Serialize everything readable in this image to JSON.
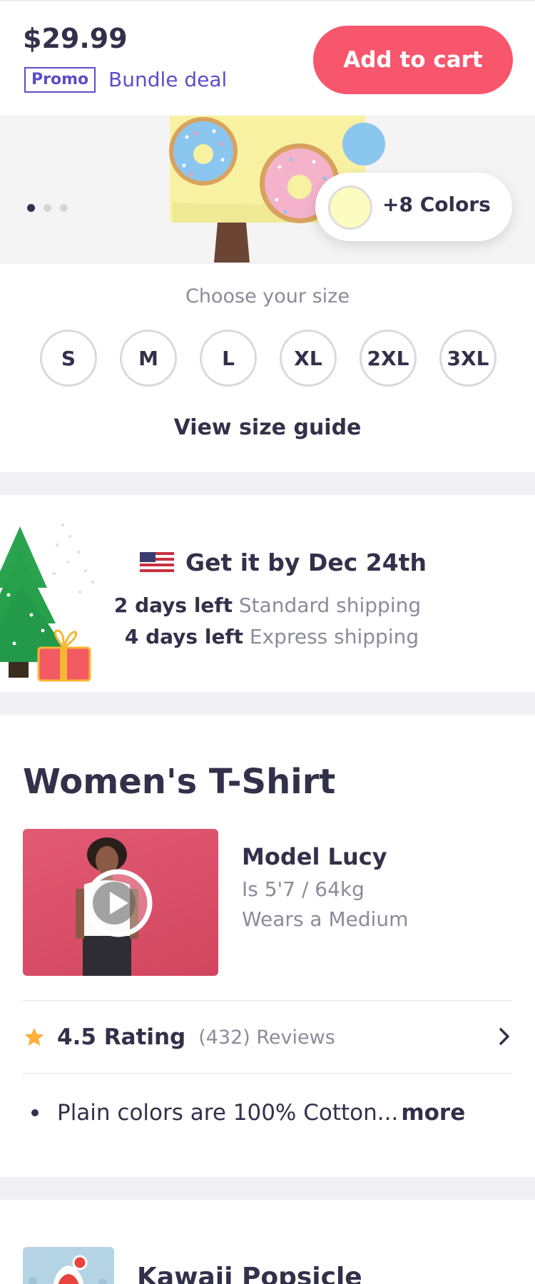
{
  "header": {
    "price": "$29.99",
    "promo_badge": "Promo",
    "promo_text": "Bundle deal",
    "add_to_cart_label": "Add to cart",
    "accent_color": "#f7566c",
    "promo_color": "#5c4ec9"
  },
  "gallery": {
    "image_count": 3,
    "active_index": 0,
    "colors_label": "+8 Colors",
    "selected_swatch_color": "#fdfcc0"
  },
  "size": {
    "title": "Choose your size",
    "options": [
      "S",
      "M",
      "L",
      "XL",
      "2XL",
      "3XL"
    ],
    "guide_label": "View size guide"
  },
  "shipping": {
    "flag_icon": "us-flag-icon",
    "title": "Get it by Dec 24th",
    "standard_days": "2 days left",
    "standard_label": "Standard shipping",
    "express_days": "4 days left",
    "express_label": "Express shipping"
  },
  "product": {
    "title": "Women's T-Shirt",
    "model_name": "Model Lucy",
    "model_size": "Is 5'7 / 64kg",
    "model_wears": "Wears a Medium",
    "rating_value": "4.5 Rating",
    "rating_count": "(432) Reviews",
    "bullet_text": "Plain colors are 100% Cotton...",
    "more_label": "more",
    "star_color": "#fbb03b"
  },
  "next_product": {
    "title": "Kawaii Popsicle"
  }
}
